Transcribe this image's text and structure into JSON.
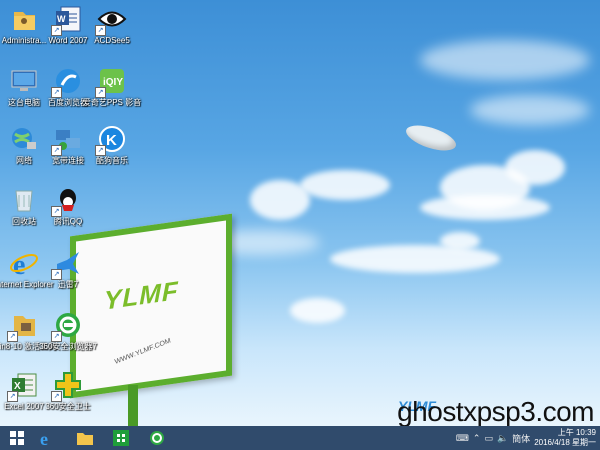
{
  "desktop_icons": [
    {
      "label": "Administra...",
      "icon": "user-folder-icon"
    },
    {
      "label": "Word 2007",
      "icon": "word-icon"
    },
    {
      "label": "ACDSee5",
      "icon": "acdsee-eye-icon"
    },
    {
      "label": "这台电脑",
      "icon": "computer-icon"
    },
    {
      "label": "百度浏览器",
      "icon": "baidu-browser-icon"
    },
    {
      "label": "爱奇艺PPS 影音",
      "icon": "iqiyi-icon"
    },
    {
      "label": "网络",
      "icon": "network-icon"
    },
    {
      "label": "宽带连接",
      "icon": "broadband-icon"
    },
    {
      "label": "酷狗音乐",
      "icon": "kugou-icon"
    },
    {
      "label": "回收站",
      "icon": "recycle-bin-icon"
    },
    {
      "label": "腾讯QQ",
      "icon": "qq-icon"
    },
    {
      "label": "Internet Explorer",
      "icon": "ie-icon"
    },
    {
      "label": "迅雷7",
      "icon": "xunlei-icon"
    },
    {
      "label": "Win8·10 激活工具",
      "icon": "activation-tool-icon"
    },
    {
      "label": "360安全浏览器7",
      "icon": "360-browser-icon"
    },
    {
      "label": "Excel 2007",
      "icon": "excel-icon"
    },
    {
      "label": "360安全卫士",
      "icon": "360-guard-icon"
    }
  ],
  "billboard": {
    "logo": "YLMF",
    "url": "WWW.YLMF.COM"
  },
  "watermark": {
    "text": "ghostxpsp3.com",
    "brand": "YLMF"
  },
  "taskbar": {
    "apps": [
      "windows-start-icon",
      "ie-icon",
      "file-explorer-icon",
      "store-icon",
      "360-browser-icon"
    ],
    "tray": {
      "ime": "簡体",
      "time": "上午 10:39",
      "date": "2016/4/18 星期一"
    }
  },
  "colors": {
    "accent_green": "#5cae2e",
    "taskbar": "#1e3c5f"
  }
}
